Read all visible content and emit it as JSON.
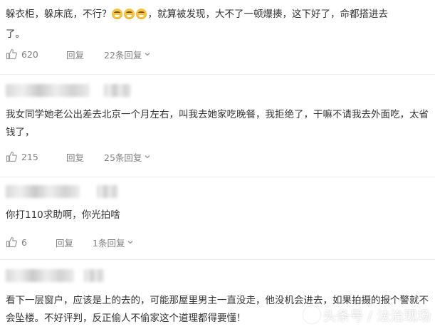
{
  "comments": [
    {
      "text_before_emoji": "躲衣柜，躲床底，不行？",
      "emoji": [
        "laugh-cry-emoji",
        "laugh-cry-emoji",
        "laugh-cry-emoji"
      ],
      "text_after_emoji": "，就算被发现，大不了一顿爆揍，这下好了，命都搭进去",
      "text_line2": "了。",
      "likes": "620",
      "reply_label": "回复",
      "reply_count": "22条回复"
    },
    {
      "text": "我女同学她老公出差去北京一个月左右，叫我去她家吃晚餐，我拒绝了，干嘛不请我去外面吃，太省钱了，",
      "likes": "215",
      "reply_label": "回复",
      "reply_count": "25条回复"
    },
    {
      "text": "你打110求助啊，你光拍啥",
      "likes": "6",
      "reply_label": "回复",
      "reply_count": "1条回复"
    },
    {
      "text": "看下一层窗户，应该是上的去的，可能那屋里男主一直没走，他没机会进去，如果拍摄的报个警就不会坠楼。不好评判，反正偷人不偷家这个道理都得要懂！"
    }
  ],
  "watermark": "头条号 / 法治现场",
  "colors": {
    "text": "#333333",
    "meta": "#808080",
    "divider": "#ececec",
    "emoji": "#f6c445"
  }
}
